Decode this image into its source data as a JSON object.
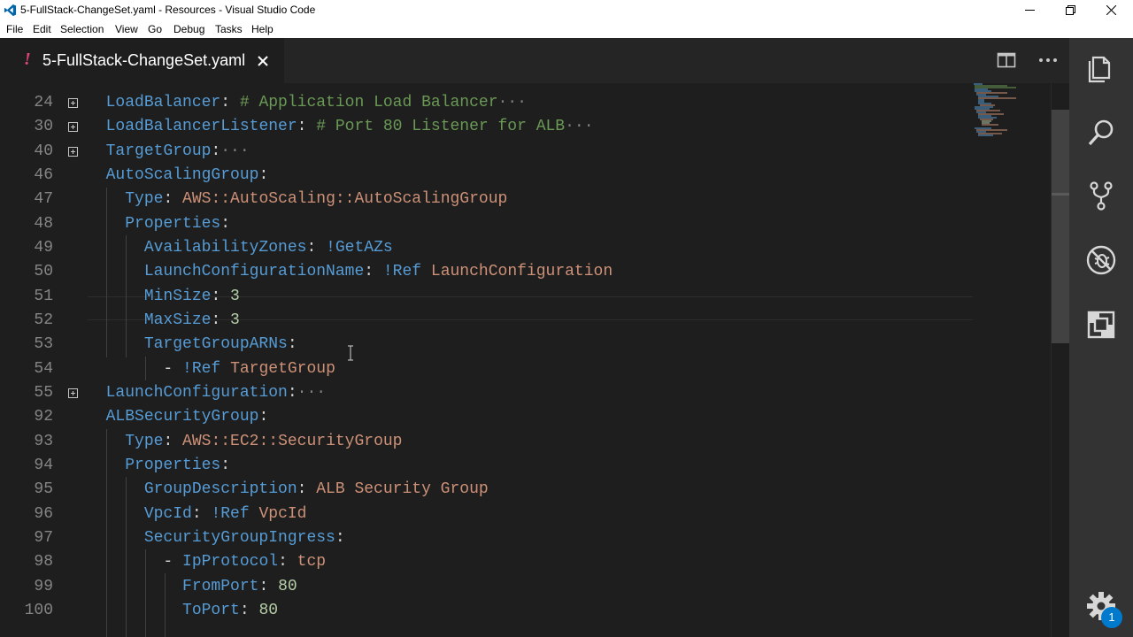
{
  "window": {
    "title": "5-FullStack-ChangeSet.yaml - Resources - Visual Studio Code"
  },
  "menu": [
    "File",
    "Edit",
    "Selection",
    "View",
    "Go",
    "Debug",
    "Tasks",
    "Help"
  ],
  "tab": {
    "modified_marker": "!",
    "label": "5-FullStack-ChangeSet.yaml"
  },
  "editor": {
    "lines": [
      {
        "num": "24",
        "foldable": true,
        "tokens": [
          {
            "t": "  ",
            "c": "p"
          },
          {
            "t": "LoadBalancer",
            "c": "k"
          },
          {
            "t": ": ",
            "c": "p"
          },
          {
            "t": "# Application Load Balancer",
            "c": "c"
          },
          {
            "t": "···",
            "c": "e"
          }
        ]
      },
      {
        "num": "30",
        "foldable": true,
        "tokens": [
          {
            "t": "  ",
            "c": "p"
          },
          {
            "t": "LoadBalancerListener",
            "c": "k"
          },
          {
            "t": ": ",
            "c": "p"
          },
          {
            "t": "# Port 80 Listener for ALB",
            "c": "c"
          },
          {
            "t": "···",
            "c": "e"
          }
        ]
      },
      {
        "num": "40",
        "foldable": true,
        "tokens": [
          {
            "t": "  ",
            "c": "p"
          },
          {
            "t": "TargetGroup",
            "c": "k"
          },
          {
            "t": ":",
            "c": "p"
          },
          {
            "t": "···",
            "c": "e"
          }
        ]
      },
      {
        "num": "46",
        "foldable": false,
        "tokens": [
          {
            "t": "  ",
            "c": "p"
          },
          {
            "t": "AutoScalingGroup",
            "c": "k"
          },
          {
            "t": ":",
            "c": "p"
          }
        ]
      },
      {
        "num": "47",
        "foldable": false,
        "tokens": [
          {
            "t": "    ",
            "c": "p"
          },
          {
            "t": "Type",
            "c": "k"
          },
          {
            "t": ": ",
            "c": "p"
          },
          {
            "t": "AWS::AutoScaling::AutoScalingGroup",
            "c": "s"
          }
        ]
      },
      {
        "num": "48",
        "foldable": false,
        "tokens": [
          {
            "t": "    ",
            "c": "p"
          },
          {
            "t": "Properties",
            "c": "k"
          },
          {
            "t": ":",
            "c": "p"
          }
        ]
      },
      {
        "num": "49",
        "foldable": false,
        "tokens": [
          {
            "t": "      ",
            "c": "p"
          },
          {
            "t": "AvailabilityZones",
            "c": "k"
          },
          {
            "t": ": ",
            "c": "p"
          },
          {
            "t": "!GetAZs",
            "c": "k"
          }
        ]
      },
      {
        "num": "50",
        "foldable": false,
        "tokens": [
          {
            "t": "      ",
            "c": "p"
          },
          {
            "t": "LaunchConfigurationName",
            "c": "k"
          },
          {
            "t": ": ",
            "c": "p"
          },
          {
            "t": "!Ref",
            "c": "k"
          },
          {
            "t": " ",
            "c": "p"
          },
          {
            "t": "LaunchConfiguration",
            "c": "s"
          }
        ]
      },
      {
        "num": "51",
        "foldable": false,
        "tokens": [
          {
            "t": "      ",
            "c": "p"
          },
          {
            "t": "MinSize",
            "c": "k"
          },
          {
            "t": ": ",
            "c": "p"
          },
          {
            "t": "3",
            "c": "n"
          }
        ]
      },
      {
        "num": "52",
        "foldable": false,
        "tokens": [
          {
            "t": "      ",
            "c": "p"
          },
          {
            "t": "MaxSize",
            "c": "k"
          },
          {
            "t": ": ",
            "c": "p"
          },
          {
            "t": "3",
            "c": "n"
          }
        ]
      },
      {
        "num": "53",
        "foldable": false,
        "tokens": [
          {
            "t": "      ",
            "c": "p"
          },
          {
            "t": "TargetGroupARNs",
            "c": "k"
          },
          {
            "t": ":",
            "c": "p"
          }
        ]
      },
      {
        "num": "54",
        "foldable": false,
        "tokens": [
          {
            "t": "        - ",
            "c": "p"
          },
          {
            "t": "!Ref",
            "c": "k"
          },
          {
            "t": " ",
            "c": "p"
          },
          {
            "t": "TargetGroup",
            "c": "s"
          }
        ]
      },
      {
        "num": "55",
        "foldable": true,
        "tokens": [
          {
            "t": "  ",
            "c": "p"
          },
          {
            "t": "LaunchConfiguration",
            "c": "k"
          },
          {
            "t": ":",
            "c": "p"
          },
          {
            "t": "···",
            "c": "e"
          }
        ]
      },
      {
        "num": "92",
        "foldable": false,
        "tokens": [
          {
            "t": "  ",
            "c": "p"
          },
          {
            "t": "ALBSecurityGroup",
            "c": "k"
          },
          {
            "t": ":",
            "c": "p"
          }
        ]
      },
      {
        "num": "93",
        "foldable": false,
        "tokens": [
          {
            "t": "    ",
            "c": "p"
          },
          {
            "t": "Type",
            "c": "k"
          },
          {
            "t": ": ",
            "c": "p"
          },
          {
            "t": "AWS::EC2::SecurityGroup",
            "c": "s"
          }
        ]
      },
      {
        "num": "94",
        "foldable": false,
        "tokens": [
          {
            "t": "    ",
            "c": "p"
          },
          {
            "t": "Properties",
            "c": "k"
          },
          {
            "t": ":",
            "c": "p"
          }
        ]
      },
      {
        "num": "95",
        "foldable": false,
        "tokens": [
          {
            "t": "      ",
            "c": "p"
          },
          {
            "t": "GroupDescription",
            "c": "k"
          },
          {
            "t": ": ",
            "c": "p"
          },
          {
            "t": "ALB Security Group",
            "c": "s"
          }
        ]
      },
      {
        "num": "96",
        "foldable": false,
        "tokens": [
          {
            "t": "      ",
            "c": "p"
          },
          {
            "t": "VpcId",
            "c": "k"
          },
          {
            "t": ": ",
            "c": "p"
          },
          {
            "t": "!Ref",
            "c": "k"
          },
          {
            "t": " ",
            "c": "p"
          },
          {
            "t": "VpcId",
            "c": "s"
          }
        ]
      },
      {
        "num": "97",
        "foldable": false,
        "tokens": [
          {
            "t": "      ",
            "c": "p"
          },
          {
            "t": "SecurityGroupIngress",
            "c": "k"
          },
          {
            "t": ":",
            "c": "p"
          }
        ]
      },
      {
        "num": "98",
        "foldable": false,
        "tokens": [
          {
            "t": "        - ",
            "c": "p"
          },
          {
            "t": "IpProtocol",
            "c": "k"
          },
          {
            "t": ": ",
            "c": "p"
          },
          {
            "t": "tcp",
            "c": "s"
          }
        ]
      },
      {
        "num": "99",
        "foldable": false,
        "tokens": [
          {
            "t": "          ",
            "c": "p"
          },
          {
            "t": "FromPort",
            "c": "k"
          },
          {
            "t": ": ",
            "c": "p"
          },
          {
            "t": "80",
            "c": "n"
          }
        ]
      },
      {
        "num": "100",
        "foldable": false,
        "tokens": [
          {
            "t": "          ",
            "c": "p"
          },
          {
            "t": "ToPort",
            "c": "k"
          },
          {
            "t": ": ",
            "c": "p"
          },
          {
            "t": "80",
            "c": "n"
          }
        ]
      }
    ]
  },
  "activity_bar": {
    "icons": [
      "files-icon",
      "search-icon",
      "source-control-icon",
      "debug-icon",
      "extensions-icon"
    ],
    "settings_badge": "1"
  },
  "colors": {
    "accent": "#007acc",
    "modified": "#e0457b"
  }
}
